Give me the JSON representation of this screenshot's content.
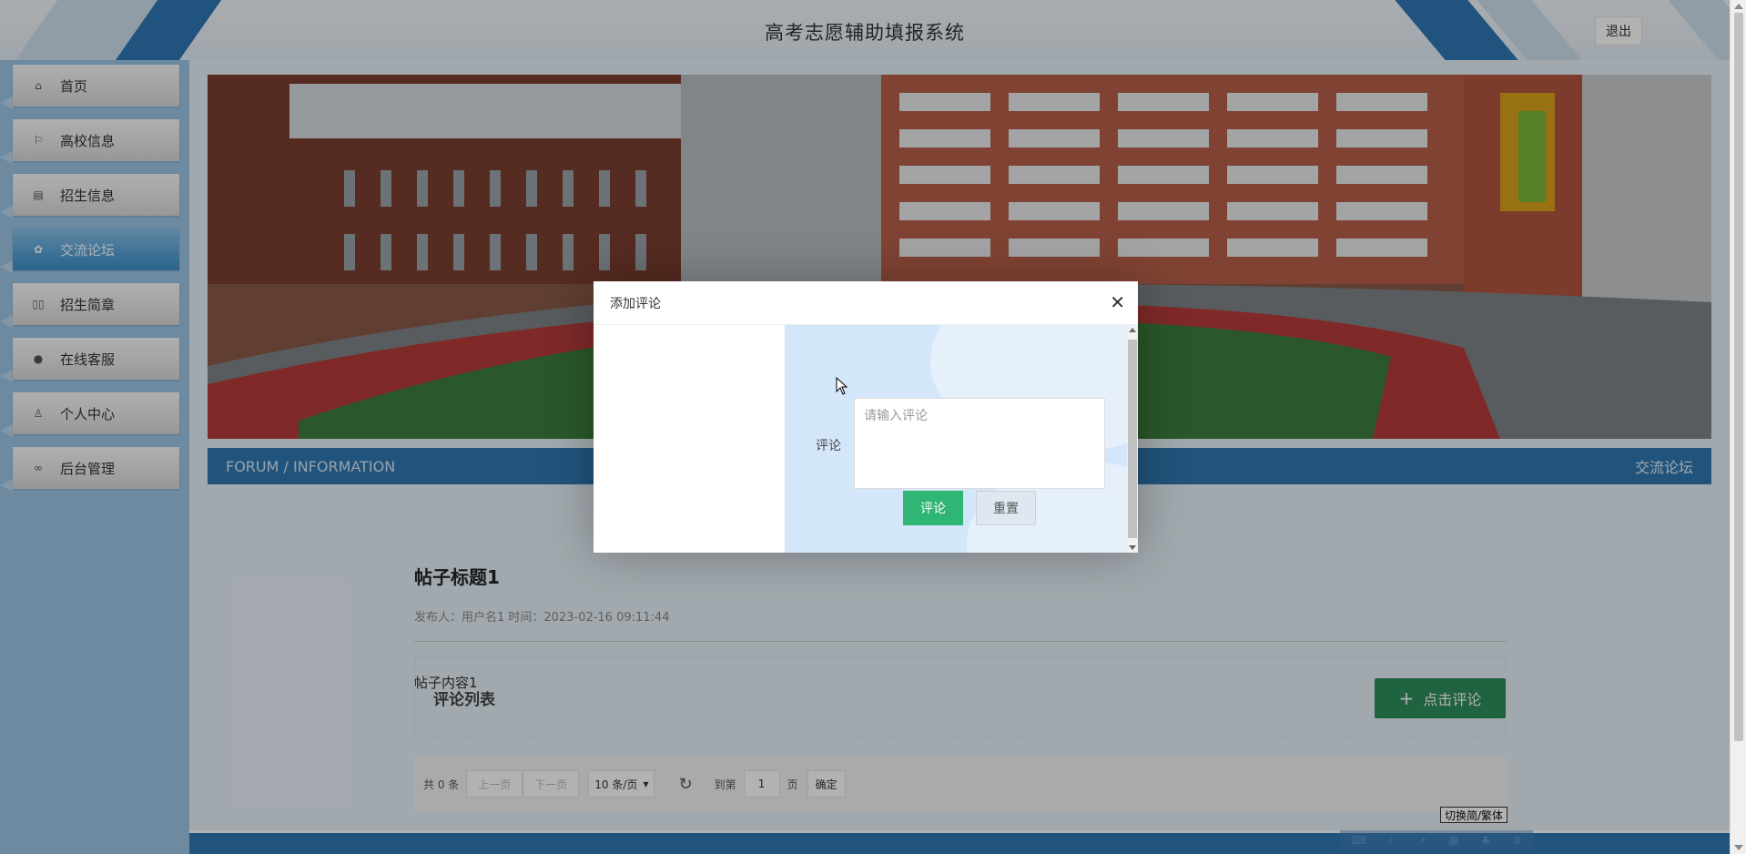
{
  "header": {
    "title": "高考志愿辅助填报系统",
    "logout_label": "退出"
  },
  "sidebar": {
    "items": [
      {
        "label": "首页",
        "icon": "home-icon"
      },
      {
        "label": "高校信息",
        "icon": "flag-icon"
      },
      {
        "label": "招生信息",
        "icon": "calendar-icon"
      },
      {
        "label": "交流论坛",
        "icon": "palette-icon",
        "active": true
      },
      {
        "label": "招生简章",
        "icon": "columns-icon"
      },
      {
        "label": "在线客服",
        "icon": "chat-icon"
      },
      {
        "label": "个人中心",
        "icon": "user-icon"
      },
      {
        "label": "后台管理",
        "icon": "link-icon"
      }
    ]
  },
  "forum_bar": {
    "left": "FORUM / INFORMATION",
    "right": "交流论坛"
  },
  "post": {
    "title": "帖子标题1",
    "meta": "发布人：用户名1 时间：2023-02-16 09:11:44",
    "content": "帖子内容1"
  },
  "comments": {
    "list_title": "评论列表",
    "add_button_label": "点击评论"
  },
  "pager": {
    "total": "共 0 条",
    "prev": "上一页",
    "next": "下一页",
    "page_size": "10 条/页",
    "goto_label": "到第",
    "page_value": "1",
    "page_unit": "页",
    "confirm": "确定"
  },
  "lang_toggle": "切换简/繁体",
  "modal": {
    "title": "添加评论",
    "field_label": "评论",
    "placeholder": "请输入评论",
    "submit": "评论",
    "reset": "重置"
  },
  "colors": {
    "primary": "#2f79b2",
    "active_nav": "#5aa5d8",
    "comment_button": "#2e8f5d",
    "submit_button": "#2fb574"
  }
}
